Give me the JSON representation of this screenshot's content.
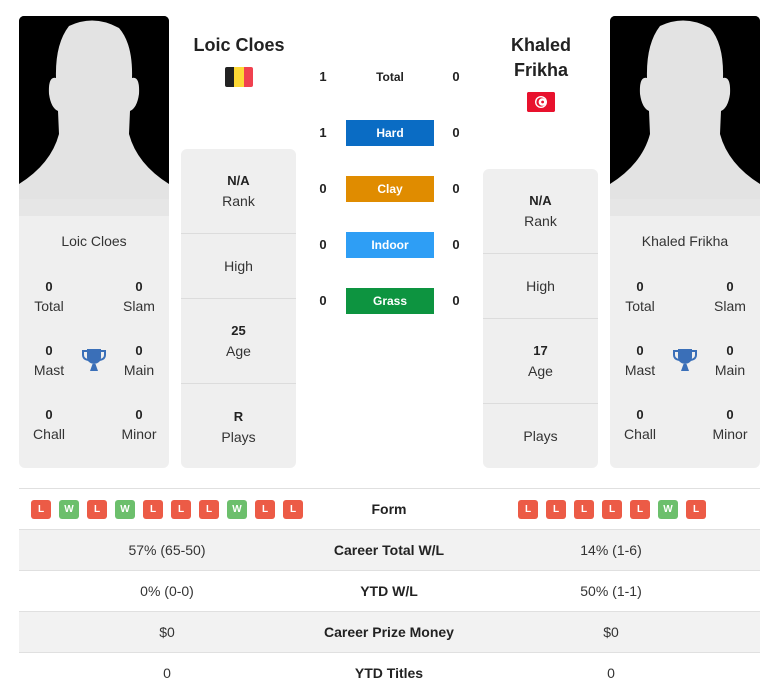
{
  "players": {
    "left": {
      "name": "Loic Cloes",
      "flag": "belgium",
      "stats": {
        "total": {
          "value": "0",
          "label": "Total"
        },
        "slam": {
          "value": "0",
          "label": "Slam"
        },
        "mast": {
          "value": "0",
          "label": "Mast"
        },
        "main": {
          "value": "0",
          "label": "Main"
        },
        "chall": {
          "value": "0",
          "label": "Chall"
        },
        "minor": {
          "value": "0",
          "label": "Minor"
        }
      },
      "info": {
        "rank": {
          "value": "N/A",
          "label": "Rank"
        },
        "high": {
          "value": "",
          "label": "High"
        },
        "age": {
          "value": "25",
          "label": "Age"
        },
        "plays": {
          "value": "R",
          "label": "Plays"
        }
      }
    },
    "right": {
      "name": "Khaled Frikha",
      "name_line1": "Khaled",
      "name_line2": "Frikha",
      "flag": "tunisia",
      "stats": {
        "total": {
          "value": "0",
          "label": "Total"
        },
        "slam": {
          "value": "0",
          "label": "Slam"
        },
        "mast": {
          "value": "0",
          "label": "Mast"
        },
        "main": {
          "value": "0",
          "label": "Main"
        },
        "chall": {
          "value": "0",
          "label": "Chall"
        },
        "minor": {
          "value": "0",
          "label": "Minor"
        }
      },
      "info": {
        "rank": {
          "value": "N/A",
          "label": "Rank"
        },
        "high": {
          "value": "",
          "label": "High"
        },
        "age": {
          "value": "17",
          "label": "Age"
        },
        "plays": {
          "value": "",
          "label": "Plays"
        }
      }
    }
  },
  "h2h": [
    {
      "label": "Total",
      "left": "1",
      "right": "0",
      "color": ""
    },
    {
      "label": "Hard",
      "left": "1",
      "right": "0",
      "color": "#0a6cc4"
    },
    {
      "label": "Clay",
      "left": "0",
      "right": "0",
      "color": "#e08c00"
    },
    {
      "label": "Indoor",
      "left": "0",
      "right": "0",
      "color": "#2e9ef5"
    },
    {
      "label": "Grass",
      "left": "0",
      "right": "0",
      "color": "#0d9440"
    }
  ],
  "comparison": {
    "form": {
      "label": "Form",
      "left": [
        "L",
        "W",
        "L",
        "W",
        "L",
        "L",
        "L",
        "W",
        "L",
        "L"
      ],
      "right": [
        "L",
        "L",
        "L",
        "L",
        "L",
        "W",
        "L"
      ]
    },
    "rows": [
      {
        "label": "Career Total W/L",
        "left": "57% (65-50)",
        "right": "14% (1-6)"
      },
      {
        "label": "YTD W/L",
        "left": "0% (0-0)",
        "right": "50% (1-1)"
      },
      {
        "label": "Career Prize Money",
        "left": "$0",
        "right": "$0"
      },
      {
        "label": "YTD Titles",
        "left": "0",
        "right": "0"
      }
    ]
  },
  "colors": {
    "win": "#6cbf6c",
    "loss": "#ec5b46",
    "trophy": "#3a6fb8",
    "card_bg": "#efefef"
  }
}
